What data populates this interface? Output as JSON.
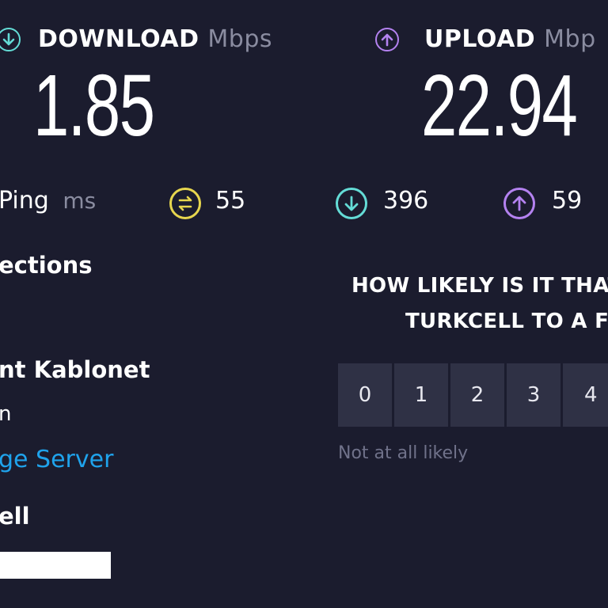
{
  "download": {
    "label": "DOWNLOAD",
    "unit": "Mbps",
    "value": "1.85",
    "icon": "download-arrow-icon",
    "color": "#64dcd6"
  },
  "upload": {
    "label": "UPLOAD",
    "unit": "Mbp",
    "value": "22.94",
    "icon": "upload-arrow-icon",
    "color": "#b482f0"
  },
  "ping": {
    "label": "Ping",
    "unit": "ms",
    "unloaded": "55",
    "download_latency": "396",
    "upload_latency": "59",
    "unloaded_color": "#e7d64e"
  },
  "sidebar": {
    "connections_label": "ections",
    "server_name": "nt Kablonet",
    "server_sub": "n",
    "change_server": "ge Server",
    "provider": "ell"
  },
  "survey": {
    "question_line1": "HOW LIKELY IS IT THAT",
    "question_line2": "TURKCELL TO A F",
    "scale": [
      "0",
      "1",
      "2",
      "3",
      "4"
    ],
    "low_hint": "Not at all likely"
  },
  "colors": {
    "background": "#1b1c2e",
    "link": "#1fa3ec",
    "button_bg": "#2f3145"
  }
}
